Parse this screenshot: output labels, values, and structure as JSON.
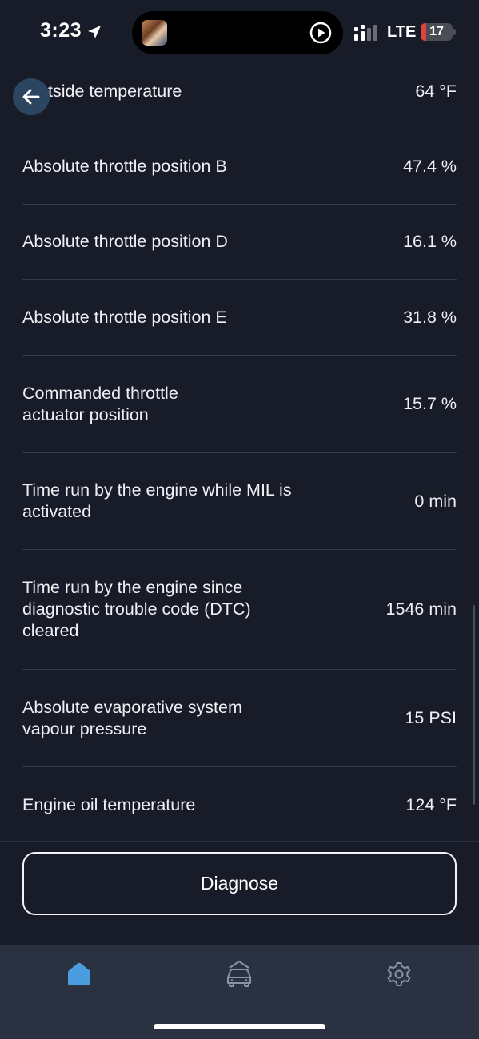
{
  "status_bar": {
    "time": "3:23",
    "network": "LTE",
    "battery_level": "17",
    "battery_fraction": 0.17,
    "battery_color": "#e3413b"
  },
  "parameters": [
    {
      "label": "Outside temperature",
      "visible_label": "tside temperature",
      "value": "64 °F"
    },
    {
      "label": "Absolute throttle position B",
      "value": "47.4 %"
    },
    {
      "label": "Absolute throttle position D",
      "value": "16.1 %"
    },
    {
      "label": "Absolute throttle position E",
      "value": "31.8 %"
    },
    {
      "label": "Commanded throttle actuator position",
      "value": "15.7 %"
    },
    {
      "label": "Time run by the engine while MIL is activated",
      "value": "0 min"
    },
    {
      "label": "Time run by the engine since diagnostic trouble code (DTC) cleared",
      "value": "1546 min"
    },
    {
      "label": "Absolute evaporative system vapour pressure",
      "value": "15 PSI"
    },
    {
      "label": "Engine oil temperature",
      "value": "124 °F"
    }
  ],
  "actions": {
    "diagnose_label": "Diagnose"
  },
  "tab_bar": {
    "tabs": [
      {
        "name": "home",
        "icon": "home-icon",
        "active": true
      },
      {
        "name": "vehicle",
        "icon": "car-icon",
        "active": false
      },
      {
        "name": "settings",
        "icon": "gear-icon",
        "active": false
      }
    ],
    "active_color": "#4a9ee0",
    "inactive_color": "#8a93a6"
  },
  "colors": {
    "background": "#181c28",
    "back_button": "#2c4560",
    "text": "#eef0f4",
    "divider": "#353a47"
  }
}
